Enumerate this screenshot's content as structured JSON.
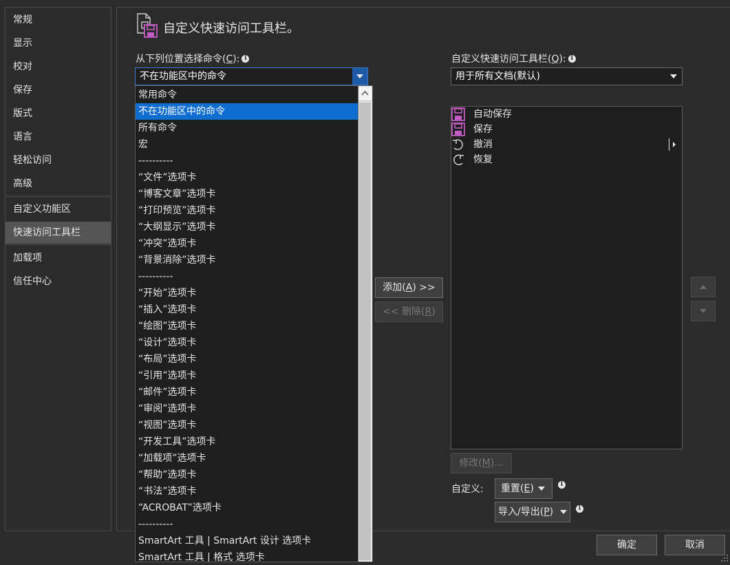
{
  "sidebar": {
    "items": [
      {
        "label": "常规"
      },
      {
        "label": "显示"
      },
      {
        "label": "校对"
      },
      {
        "label": "保存"
      },
      {
        "label": "版式"
      },
      {
        "label": "语言"
      },
      {
        "label": "轻松访问"
      },
      {
        "label": "高级"
      },
      {
        "label": "自定义功能区"
      },
      {
        "label": "快速访问工具栏"
      },
      {
        "label": "加载项"
      },
      {
        "label": "信任中心"
      }
    ],
    "active": "快速访问工具栏"
  },
  "header": {
    "title": "自定义快速访问工具栏。"
  },
  "left": {
    "label_prefix": "从下列位置选择命令(",
    "label_key": "C",
    "label_suffix": "):",
    "combo_value": "不在功能区中的命令",
    "dropdown_options": [
      "常用命令",
      "不在功能区中的命令",
      "所有命令",
      "宏",
      "----------",
      "“文件”选项卡",
      "“博客文章”选项卡",
      "“打印预览”选项卡",
      "“大纲显示”选项卡",
      "“冲突”选项卡",
      "“背景消除”选项卡",
      "----------",
      "“开始”选项卡",
      "“插入”选项卡",
      "“绘图”选项卡",
      "“设计”选项卡",
      "“布局”选项卡",
      "“引用”选项卡",
      "“邮件”选项卡",
      "“审阅”选项卡",
      "“视图”选项卡",
      "“开发工具”选项卡",
      "“加载项”选项卡",
      "“帮助”选项卡",
      "“书法”选项卡",
      "“ACROBAT”选项卡",
      "----------",
      "SmartArt 工具 | SmartArt 设计 选项卡",
      "SmartArt 工具 | 格式 选项卡"
    ],
    "selected_option": "不在功能区中的命令"
  },
  "right": {
    "label_prefix": "自定义快速访问工具栏(",
    "label_key": "Q",
    "label_suffix": "):",
    "combo_value": "用于所有文档(默认)",
    "items": [
      {
        "label": "自动保存",
        "icon": "save-icon"
      },
      {
        "label": "保存",
        "icon": "save-icon"
      },
      {
        "label": "撤消",
        "icon": "undo-icon"
      },
      {
        "label": "恢复",
        "icon": "redo-icon"
      }
    ],
    "modify_prefix": "修改(",
    "modify_key": "M",
    "modify_suffix": ")...",
    "customize_label": "自定义:",
    "reset_prefix": "重置(",
    "reset_key": "E",
    "reset_suffix": ")",
    "import_prefix": "导入/导出(",
    "import_key": "P",
    "import_suffix": ")"
  },
  "middle": {
    "add_prefix": "添加(",
    "add_key": "A",
    "add_suffix": ") >>",
    "remove_prefix": "<< 删除(",
    "remove_key": "R",
    "remove_suffix": ")"
  },
  "footer": {
    "ok_label": "确定",
    "cancel_label": "取消"
  },
  "colors": {
    "accent": "#0f6dd0",
    "icon_save": "#c35cc4",
    "background": "#2b2b2b"
  }
}
